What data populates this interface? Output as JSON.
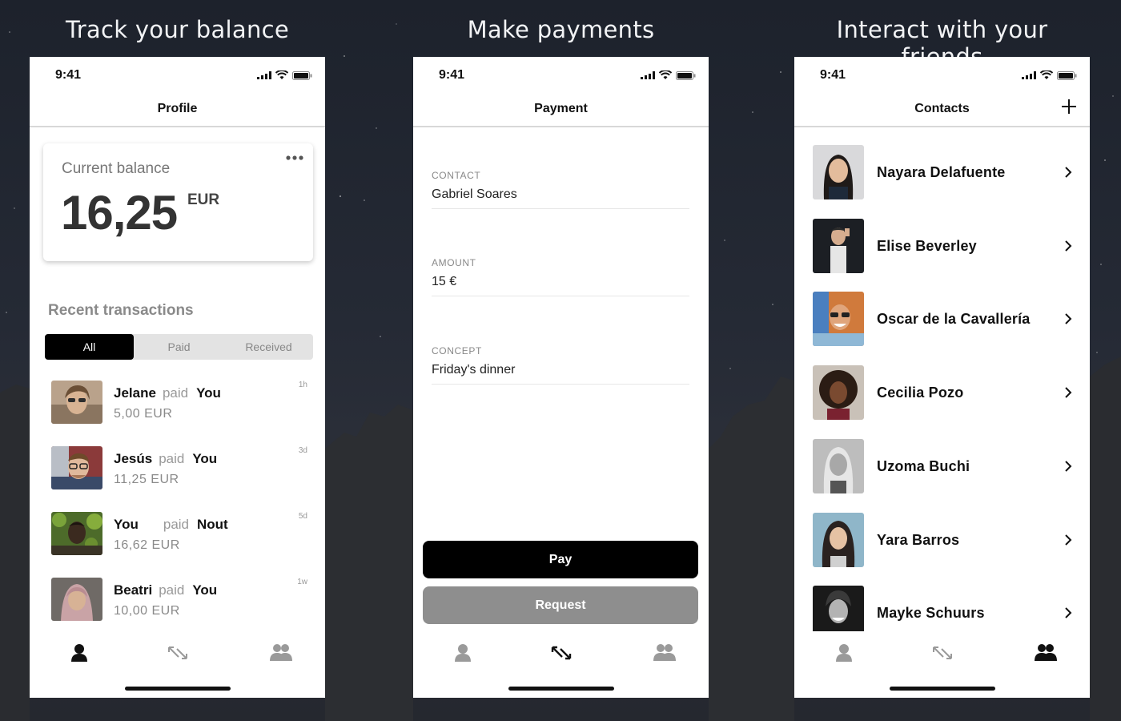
{
  "captions": [
    "Track your balance",
    "Make payments",
    "Interact with your friends"
  ],
  "status_time": "9:41",
  "profile": {
    "title": "Profile",
    "balance_label": "Current balance",
    "balance_amount": "16,25",
    "balance_currency": "EUR",
    "recent_title": "Recent transactions",
    "filters": [
      "All",
      "Paid",
      "Received"
    ],
    "transactions": [
      {
        "from": "Jelane",
        "verb": "paid",
        "to": "You",
        "amount": "5,00 EUR",
        "time": "1h"
      },
      {
        "from": "Jesús",
        "verb": "paid",
        "to": "You",
        "amount": "11,25 EUR",
        "time": "3d"
      },
      {
        "from": "You",
        "verb": "paid",
        "to": "Nout",
        "amount": "16,62 EUR",
        "time": "5d"
      },
      {
        "from": "Beatri",
        "verb": "paid",
        "to": "You",
        "amount": "10,00 EUR",
        "time": "1w"
      }
    ]
  },
  "payment": {
    "title": "Payment",
    "fields": [
      {
        "label": "CONTACT",
        "value": "Gabriel Soares"
      },
      {
        "label": "AMOUNT",
        "value": "15 €"
      },
      {
        "label": "CONCEPT",
        "value": "Friday's dinner"
      }
    ],
    "pay_label": "Pay",
    "request_label": "Request"
  },
  "contacts": {
    "title": "Contacts",
    "list": [
      "Nayara Delafuente",
      "Elise Beverley",
      "Oscar de la Cavallería",
      "Cecilia Pozo",
      "Uzoma Buchi",
      "Yara Barros",
      "Mayke Schuurs"
    ]
  },
  "icons": {
    "tab_profile": "person-icon",
    "tab_payment": "transfer-arrows-icon",
    "tab_contacts": "people-icon",
    "add": "plus-icon",
    "more": "ellipsis-icon",
    "chevron": "chevron-right-icon"
  },
  "colors": {
    "active_tab": "#111111",
    "inactive_tab": "#9a9a9a",
    "pay_button": "#000000",
    "request_button": "#8e8e8e"
  }
}
